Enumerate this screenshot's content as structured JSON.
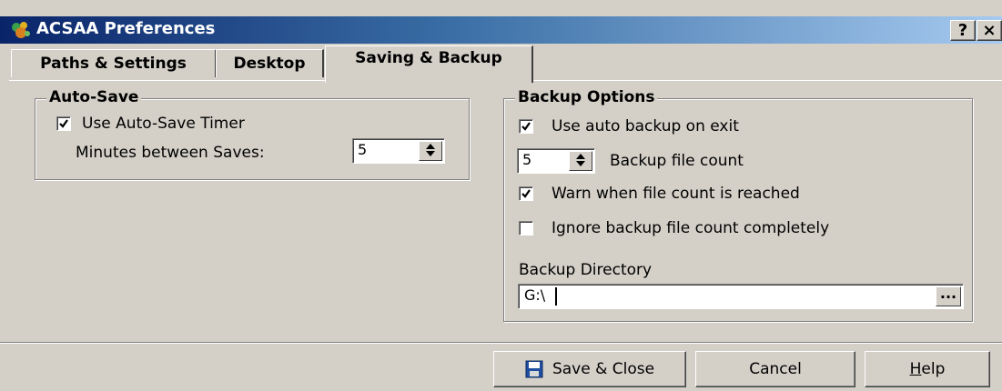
{
  "window": {
    "title": "ACSAA Preferences",
    "help_caption_button": "?",
    "close_caption_button": "×"
  },
  "tabs": [
    {
      "label": "Paths & Settings",
      "selected": false
    },
    {
      "label": "Desktop",
      "selected": false
    },
    {
      "label": "Saving & Backup",
      "selected": true
    }
  ],
  "autosave": {
    "title": "Auto-Save",
    "use_timer_label": "Use Auto-Save Timer",
    "use_timer_checked": true,
    "minutes_label": "Minutes between Saves:",
    "minutes_value": "5"
  },
  "backup": {
    "title": "Backup Options",
    "auto_backup_label": "Use auto backup on exit",
    "auto_backup_checked": true,
    "file_count_value": "5",
    "file_count_label": "Backup file count",
    "warn_label": "Warn when file count is reached",
    "warn_checked": true,
    "ignore_label": "Ignore backup file count completely",
    "ignore_checked": false,
    "directory_label": "Backup Directory",
    "directory_value": "G:\\",
    "browse_label": "..."
  },
  "buttons": {
    "save_close": "Save & Close",
    "cancel": "Cancel",
    "help_first": "H",
    "help_rest": "elp"
  }
}
